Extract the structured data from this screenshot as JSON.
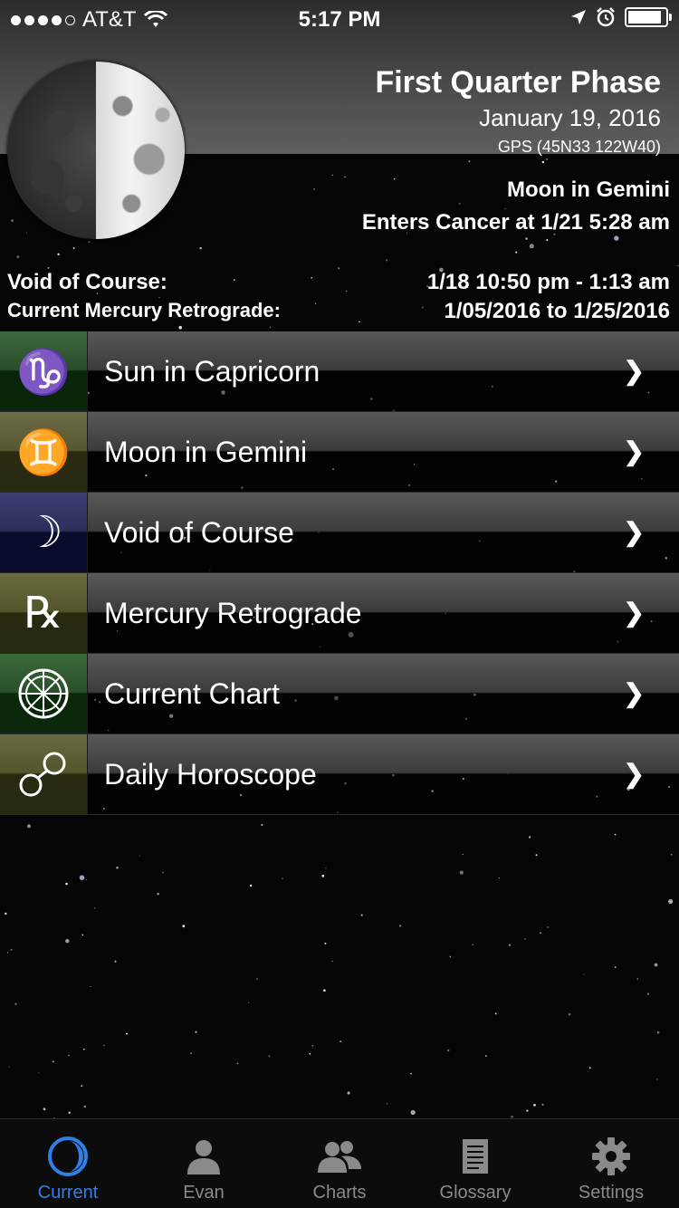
{
  "status_bar": {
    "carrier": "AT&T",
    "time": "5:17 PM",
    "signal_bars_filled": 4,
    "signal_bars_total": 5,
    "battery_level": 0.95
  },
  "header": {
    "phase_title": "First Quarter Phase",
    "date": "January 19, 2016",
    "gps": "GPS (45N33 122W40)",
    "moon_sign": "Moon in Gemini",
    "enters_next": "Enters Cancer at 1/21 5:28 am"
  },
  "info": {
    "void_label": "Void of Course:",
    "void_value": "1/18 10:50 pm - 1:13 am",
    "mercury_label": "Current Mercury Retrograde:",
    "mercury_value": "1/05/2016 to 1/25/2016"
  },
  "menu": [
    {
      "label": "Sun in Capricorn",
      "glyph": "♑",
      "icon": "capricorn-icon",
      "color": "#3e6a3e"
    },
    {
      "label": "Moon in Gemini",
      "glyph": "♊",
      "icon": "gemini-icon",
      "color": "#6c6c46"
    },
    {
      "label": "Void of Course",
      "glyph": "☽",
      "icon": "crescent-moon-icon",
      "color": "#3c3f72"
    },
    {
      "label": "Mercury Retrograde",
      "glyph": "℞",
      "icon": "retrograde-icon",
      "color": "#6a6a3e"
    },
    {
      "label": "Current Chart",
      "glyph": "",
      "icon": "chart-wheel-icon",
      "color": "#3a6a3a"
    },
    {
      "label": "Daily Horoscope",
      "glyph": "",
      "icon": "horoscope-icon",
      "color": "#6a6a40"
    }
  ],
  "tabs": [
    {
      "label": "Current",
      "icon": "moon-tab-icon",
      "active": true
    },
    {
      "label": "Evan",
      "icon": "person-icon",
      "active": false
    },
    {
      "label": "Charts",
      "icon": "people-icon",
      "active": false
    },
    {
      "label": "Glossary",
      "icon": "document-icon",
      "active": false
    },
    {
      "label": "Settings",
      "icon": "gear-icon",
      "active": false
    }
  ],
  "colors": {
    "accent": "#2f7fe6",
    "tab_inactive": "#8a8a8a"
  }
}
